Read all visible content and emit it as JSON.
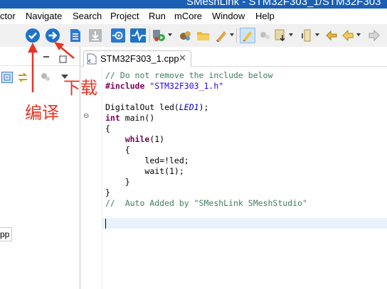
{
  "window": {
    "title": "SMeshLink - STM32F303_1/STM32F303"
  },
  "menu": [
    "ctor",
    "Navigate",
    "Search",
    "Project",
    "Run",
    "mCore",
    "Window",
    "Help"
  ],
  "left_panel": {
    "tab_label": "pp"
  },
  "editor": {
    "tab_title": "STM32F303_1.cpp",
    "code": {
      "l1": "// Do not remove the include below",
      "l2_kw": "#include",
      "l2_str": "\"STM32F303_1.h\"",
      "l4_a": "DigitalOut led(",
      "l4_b": "LED1",
      "l4_c": ");",
      "l5_kw": "int",
      "l5_rest": " main()",
      "l6": "{",
      "l7_kw": "while",
      "l7_rest": "(1)",
      "l8": "{",
      "l9": "led=!led;",
      "l10": "wait(1);",
      "l11": "}",
      "l12": "}",
      "l13": "//  Auto Added by \"SMeshLink SMeshStudio\""
    }
  },
  "annotations": {
    "compile": "编译",
    "download": "下载"
  },
  "colors": {
    "title_bar": "#1b5fb5",
    "annotation": "#ea3323",
    "comment": "#3f7f5f",
    "keyword": "#7f0055",
    "string": "#2a00ff"
  },
  "icons": [
    "build-icon",
    "upload-icon",
    "doc-icon",
    "download-disabled-icon",
    "debug-icon",
    "waveform-icon",
    "run-icon",
    "package-icon",
    "folder-icon",
    "pen-icon",
    "highlight-icon",
    "navigate-icon",
    "back-icon",
    "forward-icon"
  ]
}
